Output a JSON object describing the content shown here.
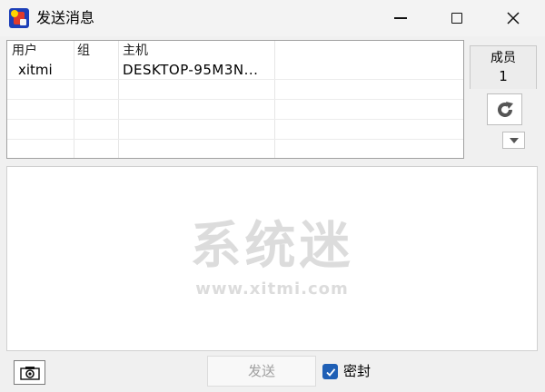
{
  "window": {
    "title": "发送消息",
    "app_icon": "app-logo-icon"
  },
  "user_table": {
    "columns": [
      "用户",
      "组",
      "主机"
    ],
    "rows": [
      {
        "user": "xitmi",
        "group": "",
        "host": "DESKTOP-95M3N..."
      }
    ]
  },
  "members": {
    "label": "成员",
    "count": "1"
  },
  "message": {
    "watermark_main": "系统迷",
    "watermark_sub": "www.xitmi.com",
    "text": ""
  },
  "footer": {
    "send_label": "发送",
    "seal_label": "密封",
    "seal_checked": true
  },
  "colors": {
    "accent": "#1f5fb5",
    "disabled_text": "#a0a0a0"
  }
}
